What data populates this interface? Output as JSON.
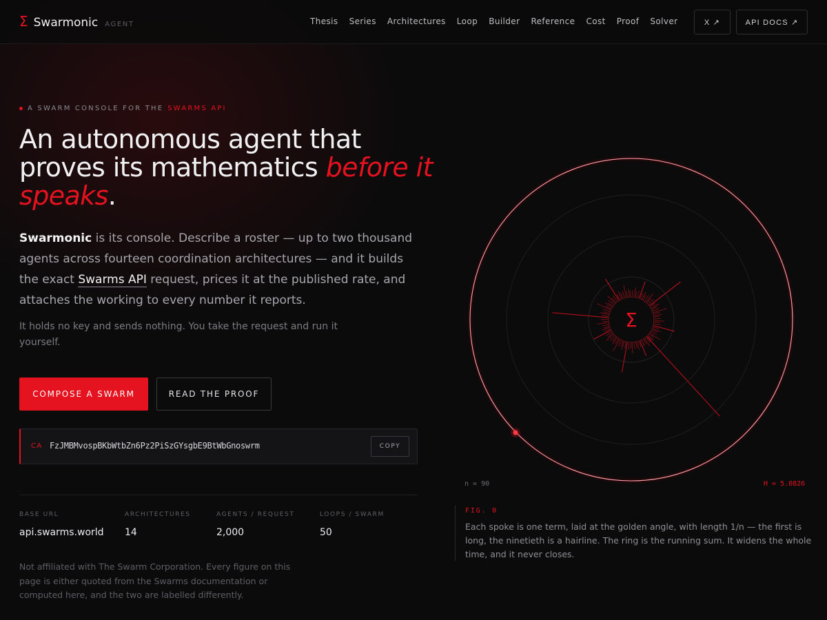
{
  "brand": {
    "logo": "Σ",
    "name": "Swarmonic",
    "tag": "AGENT"
  },
  "nav": {
    "links": [
      "Thesis",
      "Series",
      "Architectures",
      "Loop",
      "Builder",
      "Reference",
      "Cost",
      "Proof",
      "Solver"
    ],
    "x_button": "X ↗",
    "api_button": "API DOCS ↗"
  },
  "hero": {
    "eyebrow": "A SWARM CONSOLE FOR THE",
    "eyebrow_accent": "SWARMS API",
    "headline_plain": "An autonomous agent that proves its mathematics",
    "headline_accent": "before it speaks",
    "headline_end": ".",
    "lead_brand": "Swarmonic",
    "lead_1": "is its console. Describe a roster — up to two thousand agents across fourteen coordination architectures — and it builds the exact",
    "lead_link": "Swarms API",
    "lead_2": "request, prices it at the published rate, and attaches the working to every number it reports.",
    "sub": "It holds no key and sends nothing. You take the request and run it yourself.",
    "primary_cta": "COMPOSE A SWARM",
    "secondary_cta": "READ THE PROOF"
  },
  "contract": {
    "label": "CA",
    "address": "FzJMBMvospBKbWtbZn6Pz2PiSzGYsgbE9BtWbGnoswrm",
    "copy_label": "COPY"
  },
  "stats": [
    {
      "label": "BASE URL",
      "value": "api.swarms.world"
    },
    {
      "label": "ARCHITECTURES",
      "value": "14"
    },
    {
      "label": "AGENTS / REQUEST",
      "value": "2,000"
    },
    {
      "label": "LOOPS / SWARM",
      "value": "50"
    }
  ],
  "disclaimer": "Not affiliated with The Swarm Corporation. Every figure on this page is either quoted from the Swarms documentation or computed here, and the two are labelled differently.",
  "figure": {
    "center_symbol": "Σ",
    "n_label": "n = 90",
    "h_label": "H = 5.0826",
    "caption_label": "FIG. 0",
    "caption_text": "Each spoke is one term, laid at the golden angle, with length 1/n — the first is long, the ninetieth is a hairline. The ring is the running sum. It widens the whole time, and it never closes."
  },
  "colors": {
    "accent": "#e5121f",
    "background": "#0b0b0c"
  }
}
